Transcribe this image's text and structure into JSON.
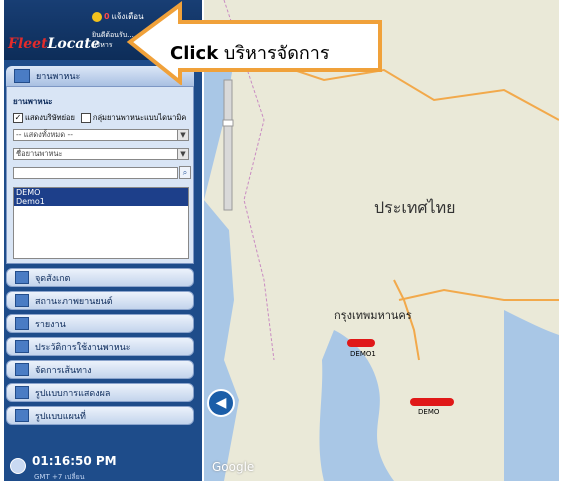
{
  "header": {
    "logo_prefix": "Fleet",
    "logo_suffix": "Locate",
    "alert_count": "0",
    "alert_label": "แจ้งเตือน",
    "user_line1": "ยินดีต้อนรับ...",
    "user_line2": "บริหาร"
  },
  "callout": {
    "strong": "Click",
    "text": " บริหารจัดการ"
  },
  "vehicle_panel": {
    "title": "ยานพาหนะ",
    "section": "ยานพาหนะ",
    "chk1": "แสดงบริษัทย่อย",
    "chk2": "กลุ่มยานพาหนะแบบไดนามิค",
    "sel1": "-- แสดงทั้งหมด --",
    "sel2": "ชื่อยานพาหนะ",
    "items": [
      "DEMO",
      "Demo1"
    ]
  },
  "menu": [
    "จุดสังเกต",
    "สถานะภาพยานยนต์",
    "รายงาน",
    "ประวัติการใช้งานพาหนะ",
    "จัดการเส้นทาง",
    "รูปแบบการแสดงผล",
    "รูปแบบแผนที่"
  ],
  "clock": {
    "time": "01:16:50 PM",
    "tz": "GMT +7 เปลี่ยน"
  },
  "map": {
    "country": "ประเทศไทย",
    "city": "กรุงเทพมหานคร",
    "vehicles": [
      {
        "name": "DEMO1"
      },
      {
        "name": "DEMO"
      }
    ],
    "attribution": "Google"
  }
}
